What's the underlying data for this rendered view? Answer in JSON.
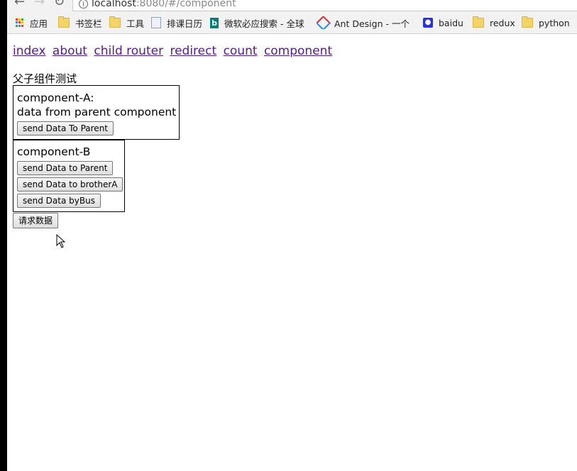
{
  "browser": {
    "url_host": "localhost",
    "url_path": ":8080/#/component",
    "bookmarks": [
      {
        "label": "应用",
        "icon": "apps-icon"
      },
      {
        "label": "书签栏",
        "icon": "folder-icon"
      },
      {
        "label": "工具",
        "icon": "folder-icon"
      },
      {
        "label": "排课日历",
        "icon": "page-icon"
      },
      {
        "label": "微软必应搜索 - 全球",
        "icon": "bing-icon"
      },
      {
        "label": "Ant Design - 一个 U",
        "icon": "ant-design-icon"
      },
      {
        "label": "baidu",
        "icon": "paw-icon"
      },
      {
        "label": "redux",
        "icon": "folder-icon"
      },
      {
        "label": "python",
        "icon": "folder-icon"
      }
    ]
  },
  "nav": {
    "links": [
      "index",
      "about",
      "child router",
      "redirect",
      "count",
      "component"
    ]
  },
  "page": {
    "section_title": "父子组件测试",
    "component_a": {
      "title": "component-A:",
      "message": "data from parent component",
      "button": "send Data To Parent"
    },
    "component_b": {
      "title": "component-B",
      "buttons": [
        "send Data to Parent",
        "send Data to brotherA",
        "send Data byBus"
      ]
    },
    "request_button": "请求数据"
  }
}
